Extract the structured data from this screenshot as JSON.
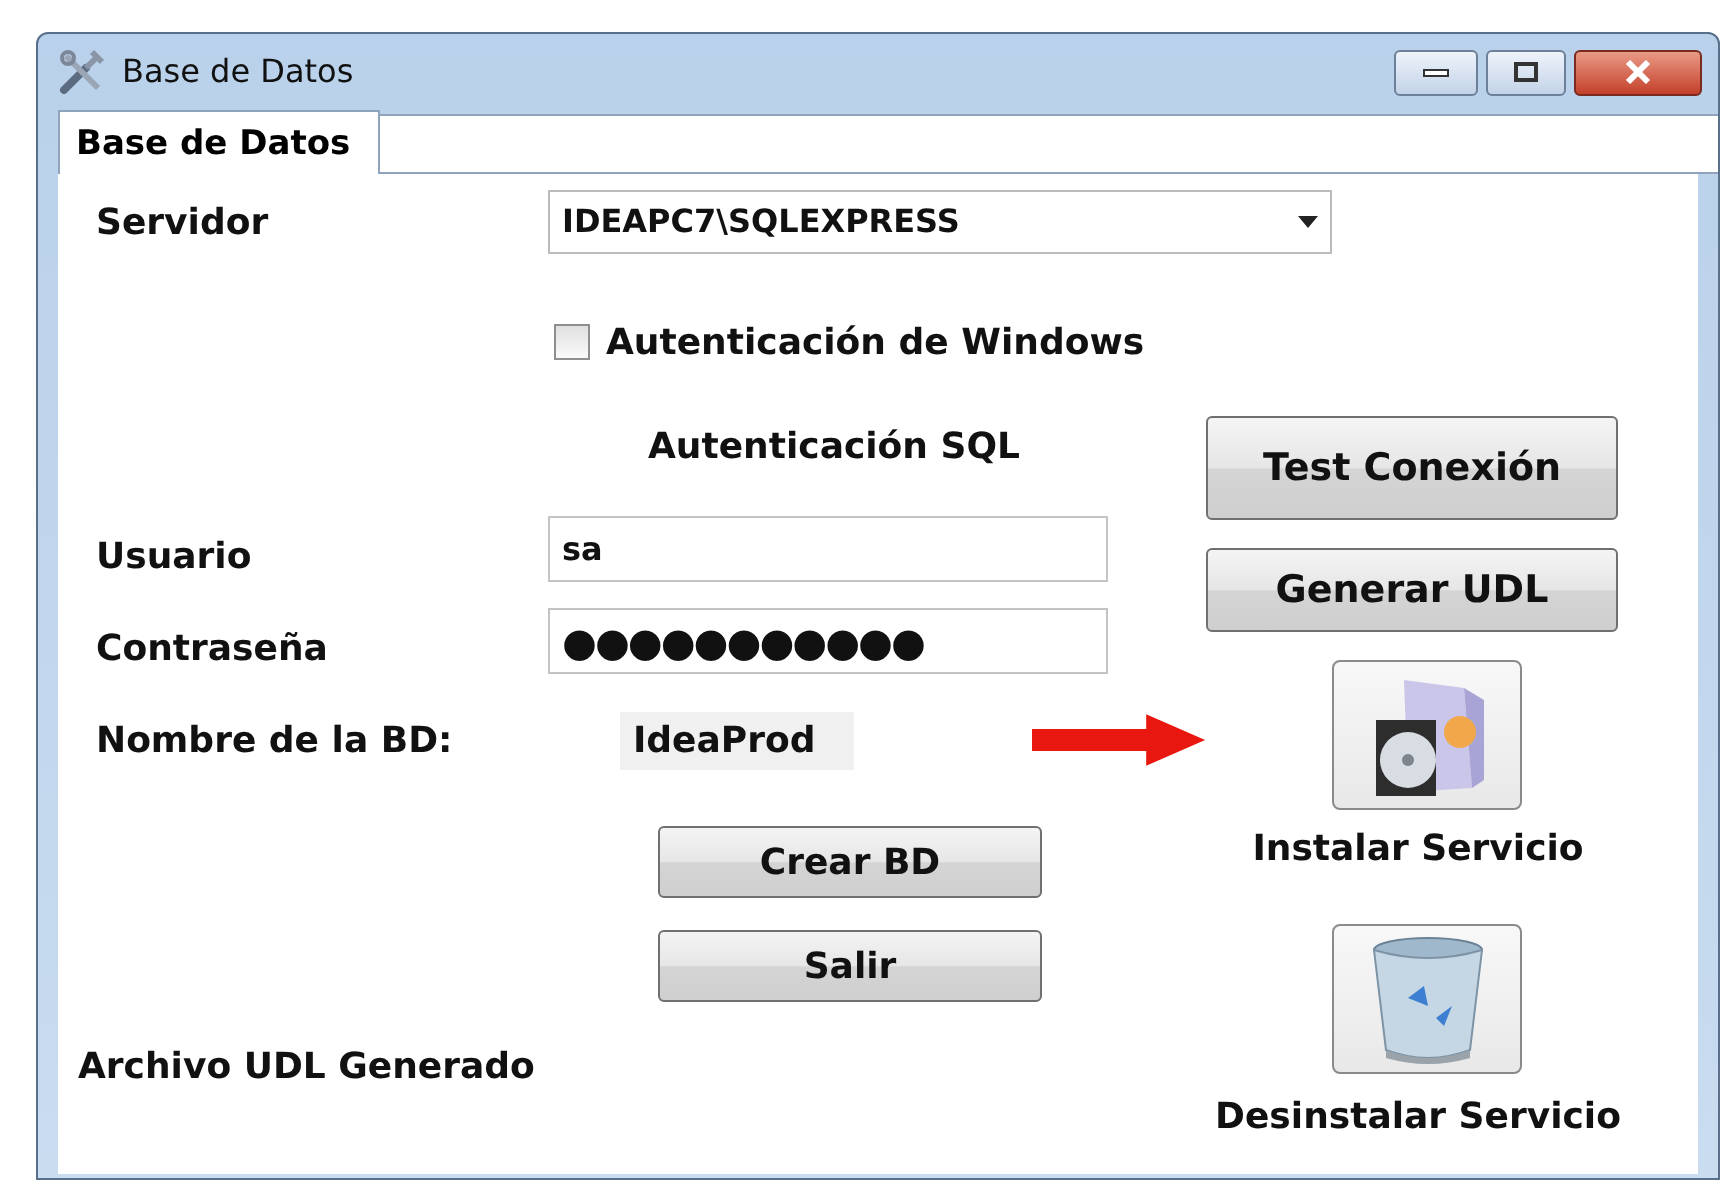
{
  "window": {
    "title": "Base de Datos"
  },
  "tabs": [
    {
      "label": "Base de Datos",
      "selected": true
    }
  ],
  "server": {
    "label": "Servidor",
    "value": "IDEAPC7\\SQLEXPRESS"
  },
  "windows_auth": {
    "label": "Autenticación de Windows",
    "checked": false
  },
  "sql_auth_heading": "Autenticación SQL",
  "user": {
    "label": "Usuario",
    "value": "sa"
  },
  "password": {
    "label": "Contraseña",
    "value": "●●●●●●●●●●●"
  },
  "database": {
    "label": "Nombre de la BD:",
    "value": "IdeaProd"
  },
  "left_buttons": [
    {
      "label": "Crear BD"
    },
    {
      "label": "Salir"
    }
  ],
  "udl_status": "Archivo UDL Generado",
  "right_buttons": [
    {
      "label": "Test Conexión"
    },
    {
      "label": "Generar UDL"
    }
  ],
  "services": [
    {
      "kind": "install",
      "label": "Instalar Servicio"
    },
    {
      "kind": "uninstall",
      "label": "Desinstalar Servicio"
    }
  ]
}
